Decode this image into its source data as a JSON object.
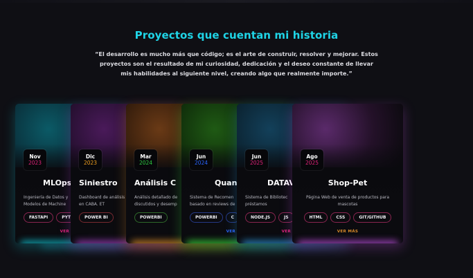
{
  "header": {
    "title": "Proyectos que cuentan mi historia",
    "quote": "“El desarrollo es mucho más que código; es el arte de construir, resolver y mejorar. Estos proyectos son el resultado de mi curiosidad, dedicación y el deseo constante de llevar mis habilidades al siguiente nivel, creando algo que realmente importe.”"
  },
  "projects": [
    {
      "month": "Nov",
      "year": "2023",
      "name": "MLOps",
      "description": "Ingeniería de Datos y Modelos de Machine",
      "tags": [
        "FASTAPI",
        "PYTH"
      ],
      "more": "VER",
      "colors": {
        "art_a": "#0b5a66",
        "art_b": "#0a2a35",
        "glow": "#10b7c6",
        "year": "#e0227a",
        "tag_border": "#8a2550",
        "more": "#e0227a"
      }
    },
    {
      "month": "Dic",
      "year": "2023",
      "name": "Siniestro",
      "description": "Dashboard de análisis en CABA. ET",
      "tags": [
        "POWER BI"
      ],
      "more": "",
      "colors": {
        "art_a": "#4a1a5a",
        "art_b": "#1e0d27",
        "glow": "#9c3fbd",
        "year": "#f0a020",
        "tag_border": "#7a2a30",
        "more": "#f0a020"
      }
    },
    {
      "month": "Mar",
      "year": "2024",
      "name": "Análisis C",
      "description": "Análisis detallado de discutidos y desemp",
      "tags": [
        "POWERBI"
      ],
      "more": "",
      "colors": {
        "art_a": "#6a3a16",
        "art_b": "#2a170a",
        "glow": "#d98a2a",
        "year": "#2ecc40",
        "tag_border": "#2f6a2a",
        "more": "#2ecc40"
      }
    },
    {
      "month": "Jun",
      "year": "2024",
      "name": "Quant",
      "description": "Sistema de Recomen basado en reviews de",
      "tags": [
        "POWERBI",
        "C"
      ],
      "more": "VER",
      "colors": {
        "art_a": "#1f5a14",
        "art_b": "#0d2609",
        "glow": "#3ad23a",
        "year": "#2a66ff",
        "tag_border": "#263a88",
        "more": "#2a66ff"
      }
    },
    {
      "month": "Jun",
      "year": "2025",
      "name": "DATAV",
      "description": "Sistema de Bibliotec préstamos",
      "tags": [
        "NODE.JS",
        "JS"
      ],
      "more": "VER",
      "colors": {
        "art_a": "#13405a",
        "art_b": "#0a1e2a",
        "glow": "#2a8fd0",
        "year": "#e0227a",
        "tag_border": "#8a2550",
        "more": "#e0227a"
      }
    },
    {
      "month": "Ago",
      "year": "2025",
      "name": "Shop-Pet",
      "description": "Página Web de venta de productos para mascotas",
      "tags": [
        "HTML",
        "CSS",
        "GIT/GITHUB"
      ],
      "more": "VER MÁS",
      "colors": {
        "art_a": "#5a2a6a",
        "art_b": "#241129",
        "glow": "#b04ad0",
        "year": "#e0227a",
        "tag_border": "#8a2550",
        "more": "#d98a2a"
      }
    }
  ]
}
